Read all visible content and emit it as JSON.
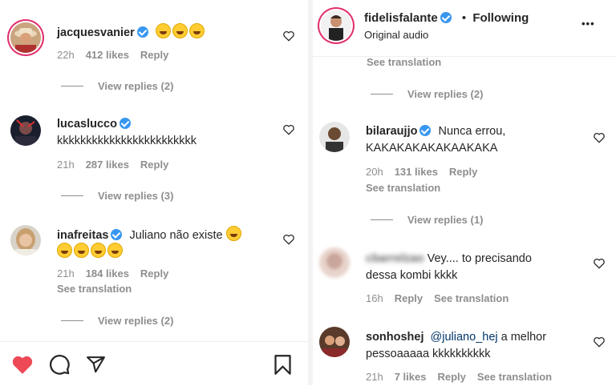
{
  "left": {
    "comments": [
      {
        "username": "jacquesvanier",
        "text": "",
        "time": "22h",
        "likes": "412 likes",
        "reply": "Reply",
        "view_replies": "View replies (2)"
      },
      {
        "username": "lucaslucco",
        "text": "kkkkkkkkkkkkkkkkkkkkkkkk",
        "time": "21h",
        "likes": "287 likes",
        "reply": "Reply",
        "view_replies": "View replies (3)"
      },
      {
        "username": "inafreitas",
        "text": "Juliano não existe",
        "time": "21h",
        "likes": "184 likes",
        "reply": "Reply",
        "see_translation": "See translation",
        "view_replies": "View replies (2)"
      }
    ]
  },
  "right": {
    "header": {
      "username": "fidelisfalante",
      "dot": "•",
      "following": "Following",
      "subtitle": "Original audio",
      "more": "•••"
    },
    "top_see_translation": "See translation",
    "top_view_replies": "View replies (2)",
    "comments": [
      {
        "username": "bilaraujjo",
        "text_line1": "Nunca errou,",
        "text_line2": "KAKAKAKAKAKAAKAKA",
        "time": "20h",
        "likes": "131 likes",
        "reply": "Reply",
        "see_translation": "See translation",
        "view_replies": "View replies (1)"
      },
      {
        "username": "cbarrelzao",
        "text_line1": "Vey.... to precisando",
        "text_line2": "dessa kombi kkkk",
        "time": "16h",
        "reply": "Reply",
        "see_translation": "See translation"
      },
      {
        "username": "sonhoshej",
        "mention": "@juliano_hej",
        "text_line1": " a melhor",
        "text_line2": "pessoaaaaa kkkkkkkkkk",
        "time": "21h",
        "likes": "7 likes",
        "reply": "Reply",
        "see_translation": "See translation"
      }
    ]
  },
  "colors": {
    "like_red": "#ed4956",
    "verified_blue": "#3897f0",
    "mention_blue": "#00376b",
    "meta_gray": "#8e8e8e"
  }
}
